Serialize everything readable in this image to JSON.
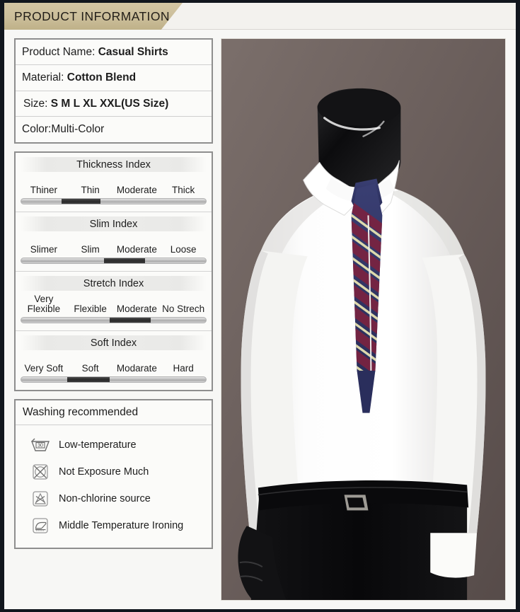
{
  "header": {
    "tab_label": "PRODUCT INFORMATION",
    "tab_color": "#cbbe9a"
  },
  "specs": {
    "rows": [
      {
        "label": "Product Name:",
        "value": "Casual Shirts"
      },
      {
        "label": "Material:",
        "value": "Cotton Blend"
      },
      {
        "label": "Size:",
        "value": "S M L XL XXL(US Size)"
      },
      {
        "label": "Color:Multi-Color",
        "value": ""
      }
    ]
  },
  "indices": [
    {
      "title": "Thickness Index",
      "labels": [
        "Thiner",
        "Thin",
        "Moderate",
        "Thick"
      ],
      "selected_index": 1,
      "fill_start_pct": 22,
      "fill_end_pct": 43
    },
    {
      "title": "Slim Index",
      "labels": [
        "Slimer",
        "Slim",
        "Moderate",
        "Loose"
      ],
      "selected_index": 2,
      "fill_start_pct": 45,
      "fill_end_pct": 67
    },
    {
      "title": "Stretch Index",
      "labels": [
        "Very Flexible",
        "Flexible",
        "Moderate",
        "No Strech"
      ],
      "selected_index": 2,
      "fill_start_pct": 48,
      "fill_end_pct": 70
    },
    {
      "title": "Soft Index",
      "labels": [
        "Very Soft",
        "Soft",
        "Modarate",
        "Hard"
      ],
      "selected_index": 1,
      "fill_start_pct": 25,
      "fill_end_pct": 48
    }
  ],
  "washing": {
    "heading": "Washing recommended",
    "items": [
      {
        "icon": "wash-tub-30-icon",
        "text": "Low-temperature"
      },
      {
        "icon": "no-tumble-dry-icon",
        "text": "Not Exposure Much"
      },
      {
        "icon": "non-chlorine-bleach-icon",
        "text": "Non-chlorine source"
      },
      {
        "icon": "iron-medium-icon",
        "text": "Middle Temperature Ironing"
      }
    ]
  },
  "photo": {
    "alt": "White casual dress shirt on mannequin with striped tie",
    "background_color": "#6b5f5c",
    "shirt_color": "#fdfdfd",
    "tie_colors": [
      "#2c3166",
      "#7a2340",
      "#e8e3b0"
    ],
    "trousers_color": "#0d0d0f"
  }
}
